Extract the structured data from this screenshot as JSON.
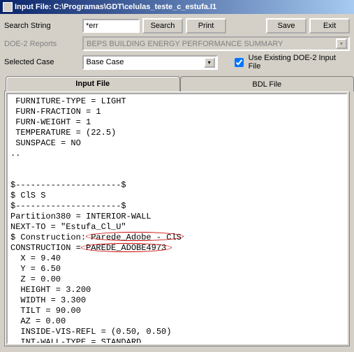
{
  "window": {
    "title": "Input File: C:\\Programas\\GDT\\celulas_teste_c_estufa.I1"
  },
  "form": {
    "search_label": "Search String",
    "search_value": "*err",
    "search_btn": "Search",
    "print_btn": "Print",
    "save_btn": "Save",
    "exit_btn": "Exit",
    "reports_label": "DOE-2 Reports",
    "reports_value": "BEPS BUILDING ENERGY PERFORMANCE SUMMARY",
    "case_label": "Selected Case",
    "case_value": "Base Case",
    "use_existing_label": "Use Existing DOE-2 Input File",
    "use_existing_checked": true
  },
  "tabs": {
    "input": "Input File",
    "bdl": "BDL File"
  },
  "file_text": " FURNITURE-TYPE = LIGHT\n FURN-FRACTION = 1\n FURN-WEIGHT = 1\n TEMPERATURE = (22.5)\n SUNSPACE = NO\n..\n\n\n$---------------------$\n$ ClS S\n$---------------------$\nPartition380 = INTERIOR-WALL\nNEXT-TO = \"Estufa_Cl_U\"\n$ Construction: Parede_Adobe - ClS\nCONSTRUCTION = PAREDE_ADOBE4973\n  X = 9.40\n  Y = 6.50\n  Z = 0.00\n  HEIGHT = 3.200\n  WIDTH = 3.300\n  TILT = 90.00\n  AZ = 0.00\n  INSIDE-VIS-REFL = (0.50, 0.50)\n  INT-WALL-TYPE = STANDARD\n..",
  "icons": {
    "dropdown": "▾"
  }
}
